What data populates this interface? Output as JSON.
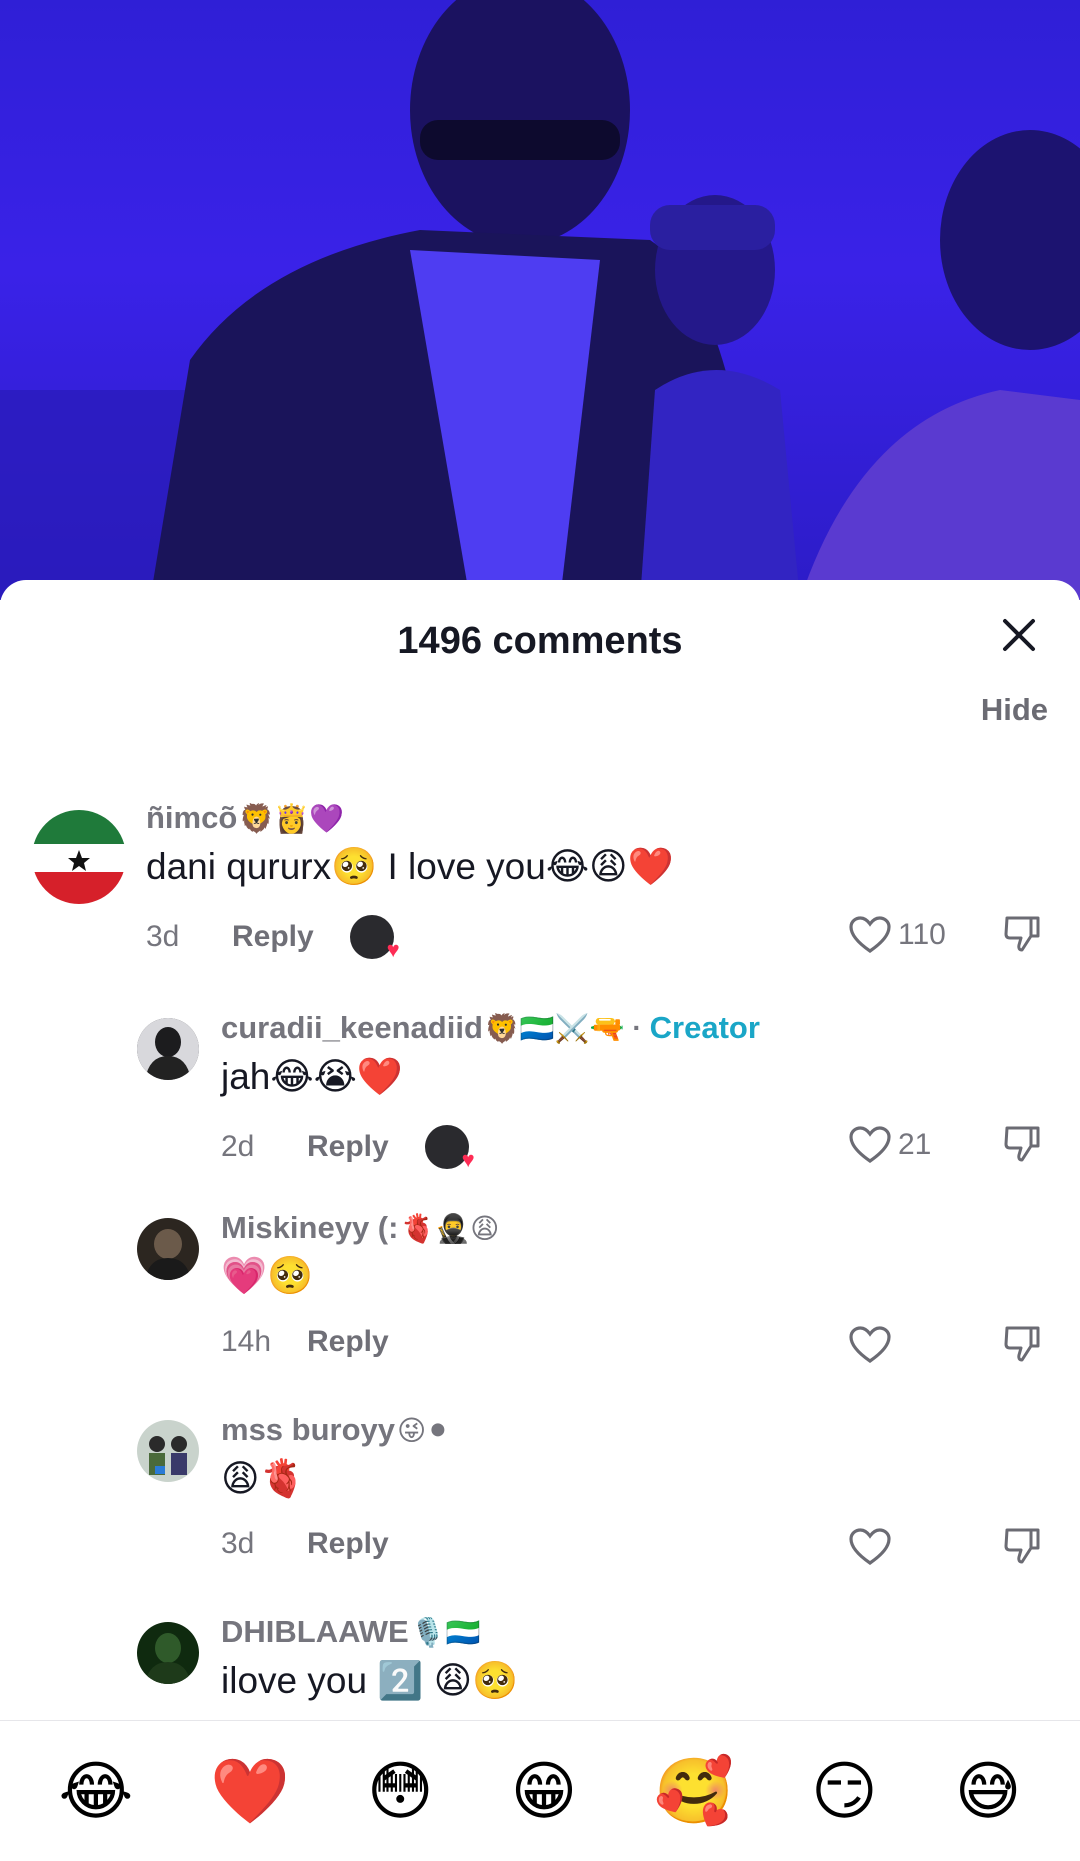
{
  "sheet": {
    "title": "1496 comments",
    "hide_label": "Hide"
  },
  "comments": [
    {
      "username": "ñimcõ",
      "username_emojis": "🦁👸💜",
      "text": "dani qururx🥺 I love you😂😩❤️",
      "time": "3d",
      "reply_label": "Reply",
      "likes": "110"
    },
    {
      "username": "curadii_keenadiid",
      "username_emojis": "🦁🇸🇱⚔️🔫",
      "creator_sep": "·",
      "creator_label": "Creator",
      "text": "jah😂😭❤️",
      "time": "2d",
      "reply_label": "Reply",
      "likes": "21"
    },
    {
      "username": "Miskineyy (:",
      "username_emojis": "🫀🥷😩",
      "text": "💗🥺",
      "time": "14h",
      "reply_label": "Reply"
    },
    {
      "username": "mss buroyy",
      "username_emojis": "😜⚫",
      "text": "😩🫀",
      "time": "3d",
      "reply_label": "Reply"
    },
    {
      "username": "DHIBLAAWE",
      "username_emojis": "🎙️🇸🇱",
      "text": "ilove you 2️⃣ 😩🥺"
    }
  ],
  "emoji_bar": [
    "😂",
    "❤️",
    "😳",
    "😁",
    "🥰",
    "😏",
    "😅"
  ],
  "colors": {
    "video_bg": "#3322e0",
    "creator": "#1aa6c7",
    "heart": "#fe2c55"
  }
}
